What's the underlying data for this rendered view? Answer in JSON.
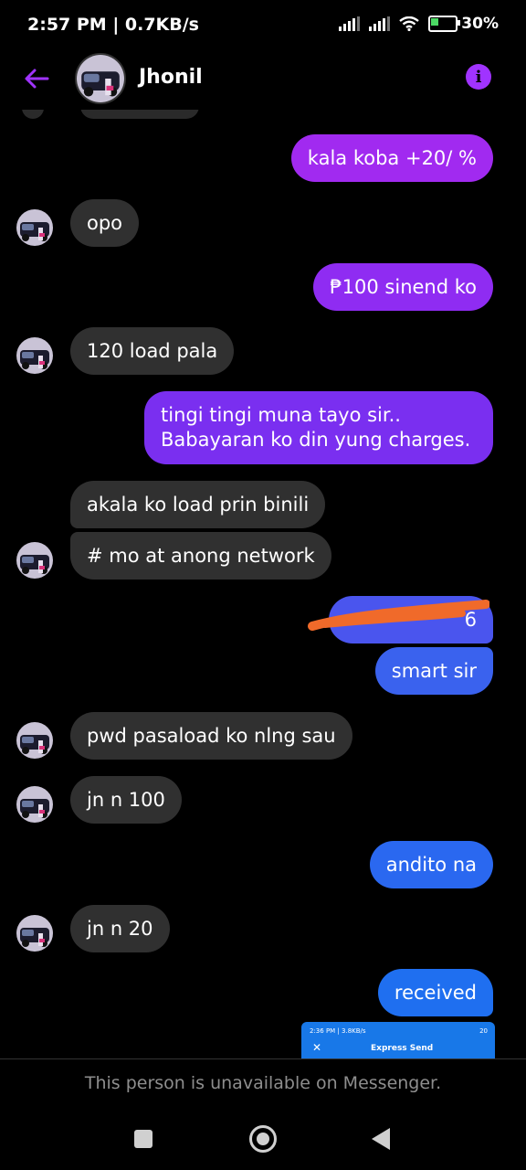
{
  "status_bar": {
    "time_speed": "2:57 PM | 0.7KB/s",
    "battery_percent": "30%"
  },
  "header": {
    "contact_name": "Jhonil"
  },
  "messages": [
    {
      "text": "kala koba +20/ %"
    },
    {
      "text": "opo"
    },
    {
      "text": "₱100 sinend ko"
    },
    {
      "text": "120 load pala"
    },
    {
      "text": "tingi tingi muna tayo sir.. Babayaran ko din yung charges."
    },
    {
      "text": "akala ko load prin binili"
    },
    {
      "text": "# mo at anong network"
    },
    {
      "text": "6"
    },
    {
      "text": "smart sir"
    },
    {
      "text": "pwd pasaload ko nlng sau"
    },
    {
      "text": "jn n 100"
    },
    {
      "text": "andito na"
    },
    {
      "text": "jn n 20"
    },
    {
      "text": "received"
    }
  ],
  "shared_screenshot": {
    "status_left": "2:36 PM | 3.8KB/s",
    "status_right": "20",
    "title": "Express Send"
  },
  "footer": {
    "unavailable_text": "This person is unavailable on Messenger."
  },
  "colors": {
    "accent": "#a033ff",
    "outgoing_purple": "#7a2ff0",
    "outgoing_blue": "#1f6ff0",
    "incoming": "#303030",
    "redaction": "#f06a2a"
  }
}
